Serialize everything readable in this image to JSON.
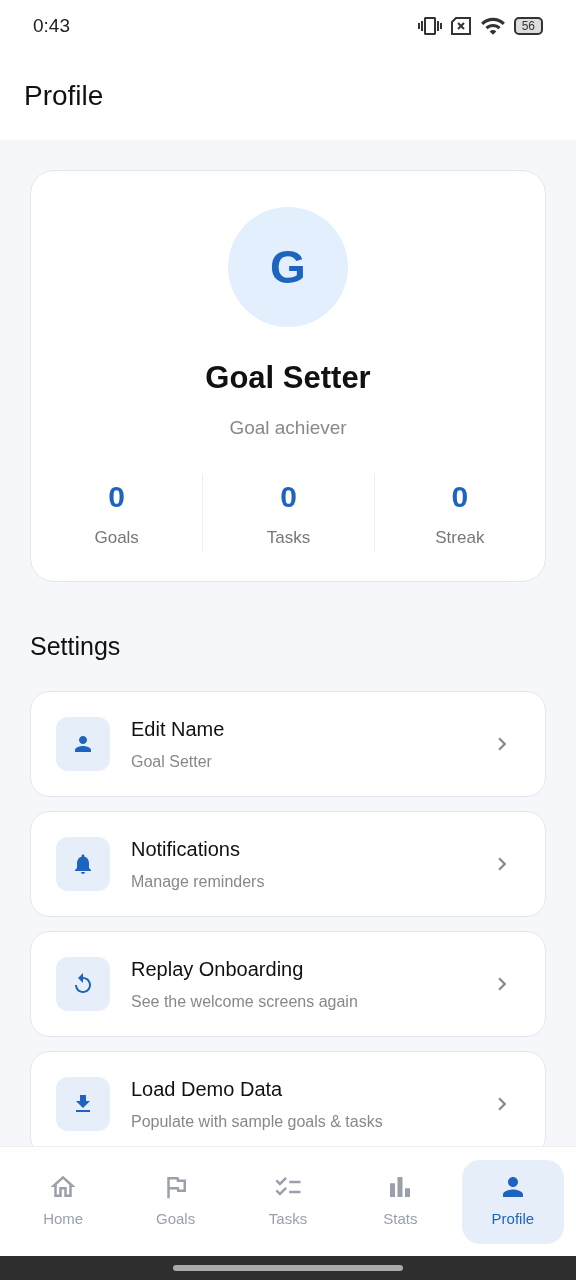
{
  "status_bar": {
    "time": "0:43",
    "battery": "56"
  },
  "header": {
    "title": "Profile"
  },
  "profile": {
    "avatar_letter": "G",
    "name": "Goal Setter",
    "subtitle": "Goal achiever",
    "stats": [
      {
        "value": "0",
        "label": "Goals"
      },
      {
        "value": "0",
        "label": "Tasks"
      },
      {
        "value": "0",
        "label": "Streak"
      }
    ]
  },
  "settings": {
    "title": "Settings",
    "items": [
      {
        "kind": "person",
        "title": "Edit Name",
        "subtitle": "Goal Setter"
      },
      {
        "kind": "bell",
        "title": "Notifications",
        "subtitle": "Manage reminders"
      },
      {
        "kind": "replay",
        "title": "Replay Onboarding",
        "subtitle": "See the welcome screens again"
      },
      {
        "kind": "download",
        "title": "Load Demo Data",
        "subtitle": "Populate with sample goals & tasks"
      }
    ]
  },
  "nav": [
    {
      "kind": "home",
      "label": "Home",
      "selected": false
    },
    {
      "kind": "flag",
      "label": "Goals",
      "selected": false
    },
    {
      "kind": "tasks",
      "label": "Tasks",
      "selected": false
    },
    {
      "kind": "stats",
      "label": "Stats",
      "selected": false
    },
    {
      "kind": "person",
      "label": "Profile",
      "selected": true
    }
  ]
}
